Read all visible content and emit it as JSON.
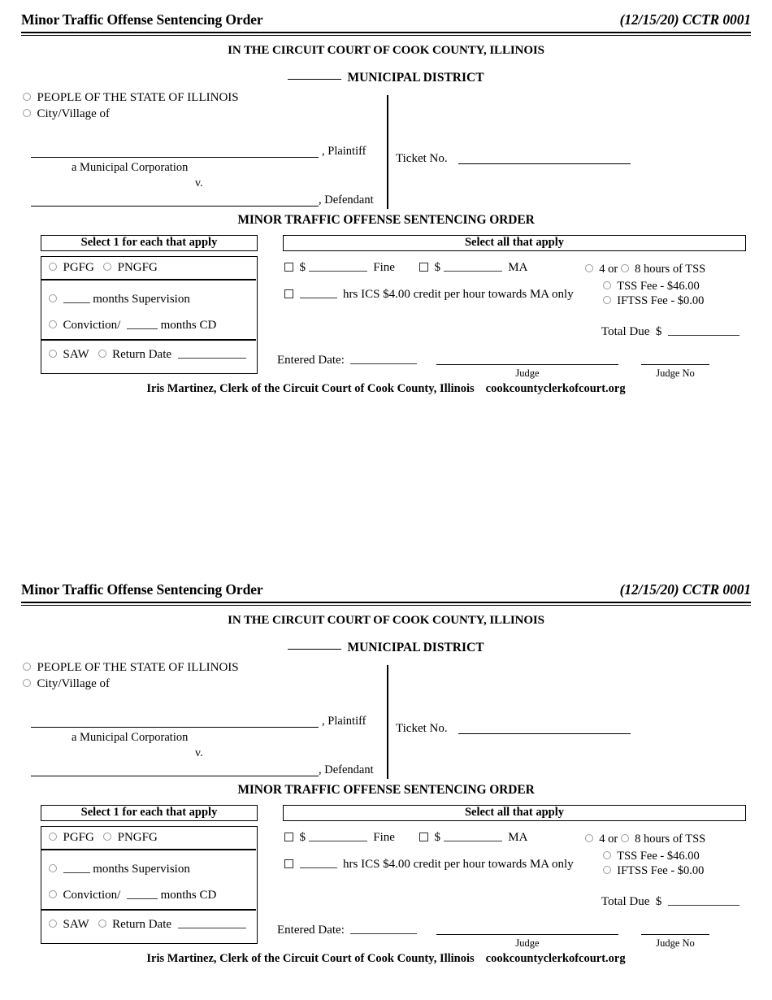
{
  "document": {
    "header": {
      "title": "Minor Traffic Offense Sentencing Order",
      "code": "(12/15/20) CCTR 0001"
    },
    "court_heading": "IN THE CIRCUIT COURT OF COOK COUNTY, ILLINOIS",
    "district_line": "MUNICIPAL DISTRICT",
    "caption": {
      "people_option": "PEOPLE OF THE STATE OF ILLINOIS",
      "city_village_option": "City/Village of",
      "plaintiff_label": ", Plaintiff",
      "municipal_corp_label": "a Municipal Corporation",
      "versus_label": "v.",
      "defendant_label": ", Defendant",
      "ticket_label": "Ticket No."
    },
    "subtitle": "MINOR TRAFFIC OFFENSE SENTENCING ORDER",
    "left_panel": {
      "heading": "Select 1 for each that apply",
      "finding_pgfg": "PGFG",
      "finding_pngfg": "PNGFG",
      "supervision_suffix": "months Supervision",
      "conviction_prefix": "Conviction/",
      "conviction_suffix": "months CD",
      "saw_label": "SAW",
      "return_date_label": "Return Date"
    },
    "right_panel": {
      "heading": "Select all that apply",
      "fine_currency": "$",
      "fine_label": "Fine",
      "ma_currency": "$",
      "ma_label": "MA",
      "ics_text": "hrs ICS $4.00 credit per hour towards MA only"
    },
    "tss_panel": {
      "hours_prefix": "4 or",
      "hours_suffix": "8 hours of TSS",
      "tss_fee": "TSS Fee - $46.00",
      "iftss_fee": "IFTSS Fee - $0.00",
      "total_due_label": "Total Due",
      "total_due_currency": "$"
    },
    "signature": {
      "entered_date_label": "Entered Date:",
      "judge_caption": "Judge",
      "judge_no_caption": "Judge No"
    },
    "footer": {
      "clerk_line": "Iris Martinez, Clerk of the Circuit Court of Cook County, Illinois",
      "website": "cookcountyclerkofcourt.org"
    }
  }
}
